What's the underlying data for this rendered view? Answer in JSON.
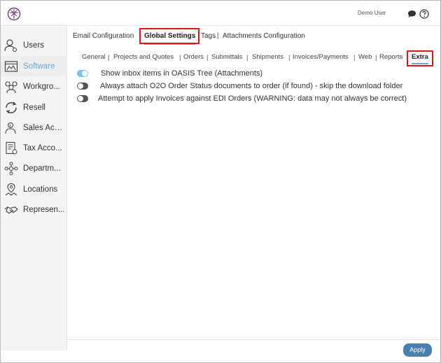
{
  "header": {
    "user_name": "Demo User",
    "icons": [
      "logo-icon",
      "chat-icon",
      "help-icon"
    ]
  },
  "sidebar": {
    "items": [
      {
        "label": "Users",
        "icon": "users-icon"
      },
      {
        "label": "Software",
        "icon": "software-icon",
        "active": true
      },
      {
        "label": "Workgro...",
        "icon": "workgroups-icon"
      },
      {
        "label": "Resell",
        "icon": "resell-icon"
      },
      {
        "label": "Sales Acc...",
        "icon": "sales-accounts-icon"
      },
      {
        "label": "Tax Acco...",
        "icon": "tax-accounts-icon"
      },
      {
        "label": "Departm...",
        "icon": "departments-icon"
      },
      {
        "label": "Locations",
        "icon": "locations-icon"
      },
      {
        "label": "Represen...",
        "icon": "representatives-icon"
      }
    ]
  },
  "tabs": [
    {
      "label": "Email Configuration"
    },
    {
      "label": "Global Settings",
      "active": true
    },
    {
      "label": "Tags"
    },
    {
      "label": "Attachments Configuration"
    }
  ],
  "subtabs": [
    {
      "label": "General"
    },
    {
      "label": "Projects and Quotes"
    },
    {
      "label": "Orders"
    },
    {
      "label": "Submittals"
    },
    {
      "label": "Shipments"
    },
    {
      "label": "Invoices/Payments"
    },
    {
      "label": "Web"
    },
    {
      "label": "Reports"
    },
    {
      "label": "Extra",
      "active": true
    }
  ],
  "separator": "|",
  "options": [
    {
      "label": "Show inbox items in OASIS Tree (Attachments)",
      "enabled": true
    },
    {
      "label": "Always attach O2O Order Status documents to order (if found) - skip the download folder",
      "enabled": false
    },
    {
      "label": "Attempt to apply Invoices against EDI Orders (WARNING: data may not always be correct)",
      "enabled": false
    }
  ],
  "footer": {
    "apply_label": "Apply"
  },
  "colors": {
    "accent": "#6aa5dc",
    "highlight_box": "#d8161f",
    "apply_button": "#4a7fb0",
    "toggle_on": "#7bbfec",
    "toggle_off": "#555555"
  }
}
